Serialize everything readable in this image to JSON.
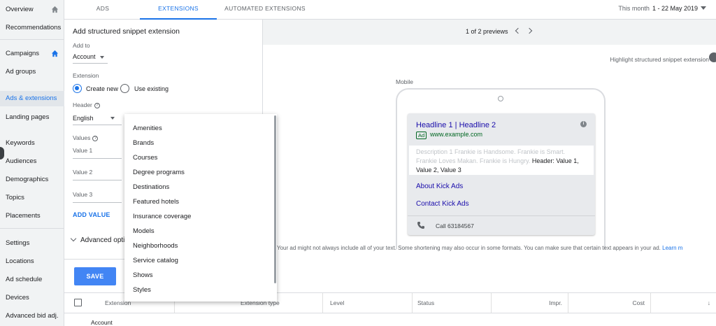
{
  "nav": {
    "items": [
      {
        "label": "Overview",
        "home": true
      },
      {
        "label": "Recommendations"
      },
      {
        "label": "Campaigns",
        "home": true,
        "home_color": "#1a73e8"
      },
      {
        "label": "Ad groups"
      },
      {
        "label": "Ads & extensions",
        "active": true
      },
      {
        "label": "Landing pages"
      },
      {
        "label": "Keywords"
      },
      {
        "label": "Audiences"
      },
      {
        "label": "Demographics"
      },
      {
        "label": "Topics"
      },
      {
        "label": "Placements"
      },
      {
        "label": "Settings"
      },
      {
        "label": "Locations"
      },
      {
        "label": "Ad schedule"
      },
      {
        "label": "Devices"
      },
      {
        "label": "Advanced bid adj."
      }
    ]
  },
  "tabs": [
    {
      "label": "ADS",
      "active": false
    },
    {
      "label": "EXTENSIONS",
      "active": true
    },
    {
      "label": "AUTOMATED EXTENSIONS",
      "active": false
    }
  ],
  "date": {
    "prefix": "This month",
    "range": "1 - 22 May 2019"
  },
  "form": {
    "title": "Add structured snippet extension",
    "add_to_label": "Add to",
    "add_to_value": "Account",
    "extension_label": "Extension",
    "create_new": "Create new",
    "use_existing": "Use existing",
    "header_label": "Header",
    "header_value": "English",
    "values_label": "Values",
    "value_placeholders": [
      "Value 1",
      "Value 2",
      "Value 3"
    ],
    "add_value": "ADD VALUE",
    "advanced": "Advanced opti",
    "save": "SAVE"
  },
  "dropdown": {
    "options": [
      "Amenities",
      "Brands",
      "Courses",
      "Degree programs",
      "Destinations",
      "Featured hotels",
      "Insurance coverage",
      "Models",
      "Neighborhoods",
      "Service catalog",
      "Shows",
      "Styles"
    ]
  },
  "preview": {
    "count": "1 of 2 previews",
    "highlight": "Highlight structured snippet extension",
    "mobile_label": "Mobile",
    "ad": {
      "headline": "Headline 1 | Headline 2",
      "badge": "Ad",
      "url": "www.example.com",
      "desc_faded": "Description 1 Frankie is Handsome. Frankie is Smart. Frankie Loves Makan. Frankie is Hungry.",
      "desc_header": " Header: Value 1, Value 2, Value 3",
      "link1": "About Kick Ads",
      "link2": "Contact Kick Ads",
      "call": "Call 63184567"
    },
    "disclaimer": "Your ad might not always include all of your text. Some shortening may also occur in some formats. You can make sure that certain text appears in your ad.",
    "learn_more": "Learn m"
  },
  "table": {
    "headers": [
      "Extension",
      "Extension type",
      "Level",
      "Status",
      "Impr.",
      "Cost"
    ],
    "rows": [
      [
        "Account"
      ]
    ]
  },
  "colors": {
    "accent": "#1a73e8",
    "button": "#4285f4",
    "ad_green": "#006621",
    "ad_link": "#1a0dab"
  }
}
